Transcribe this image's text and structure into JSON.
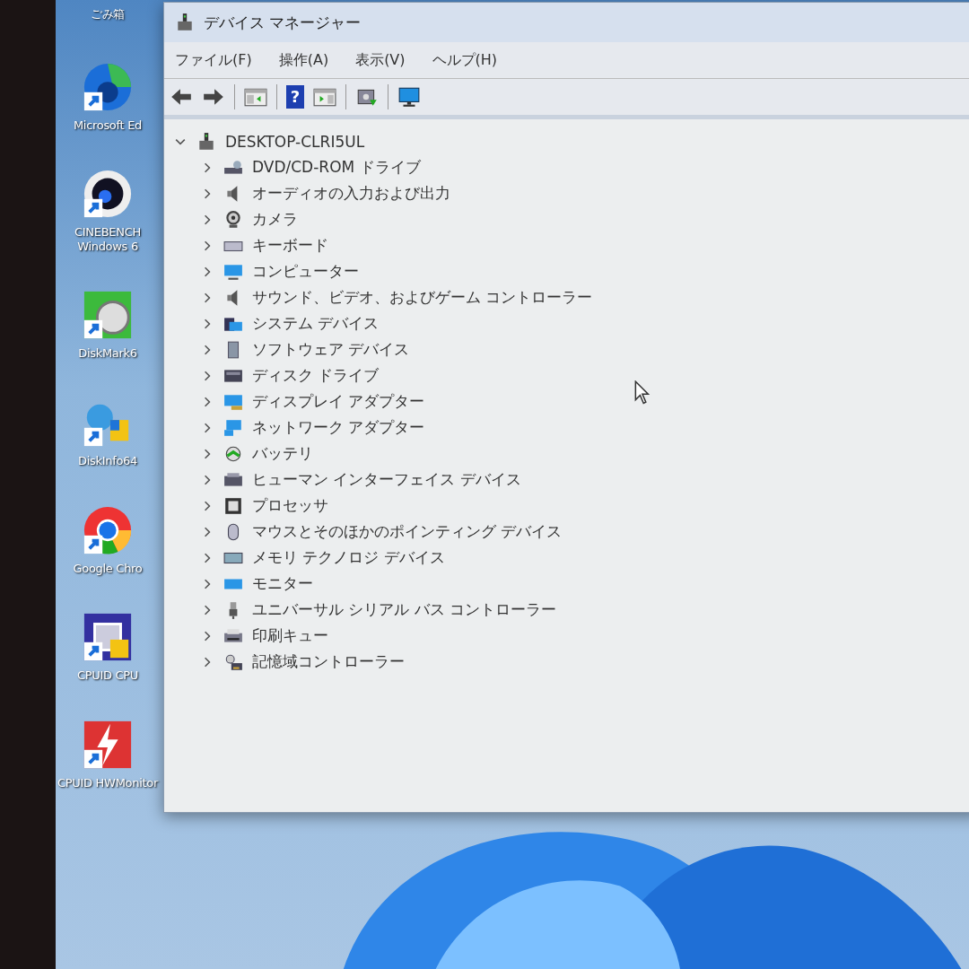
{
  "desktop_icons": [
    {
      "label": "ごみ箱"
    },
    {
      "label": "Microsoft Ed"
    },
    {
      "label": "CINEBENCH Windows 6"
    },
    {
      "label": "DiskMark6"
    },
    {
      "label": "DiskInfo64"
    },
    {
      "label": "Google Chro"
    },
    {
      "label": "CPUID CPU"
    },
    {
      "label": "CPUID HWMonitor"
    }
  ],
  "window": {
    "title": "デバイス マネージャー",
    "help_glyph": "?",
    "menu": [
      {
        "label": "ファイル(F)"
      },
      {
        "label": "操作(A)"
      },
      {
        "label": "表示(V)"
      },
      {
        "label": "ヘルプ(H)"
      }
    ],
    "tree": {
      "label": "DESKTOP-CLRI5UL",
      "expanded": true,
      "children": [
        {
          "label": "DVD/CD-ROM ドライブ",
          "expanded": false
        },
        {
          "label": "オーディオの入力および出力",
          "expanded": false
        },
        {
          "label": "カメラ",
          "expanded": false
        },
        {
          "label": "キーボード",
          "expanded": false
        },
        {
          "label": "コンピューター",
          "expanded": false
        },
        {
          "label": "サウンド、ビデオ、およびゲーム コントローラー",
          "expanded": false
        },
        {
          "label": "システム デバイス",
          "expanded": false
        },
        {
          "label": "ソフトウェア デバイス",
          "expanded": false
        },
        {
          "label": "ディスク ドライブ",
          "expanded": false
        },
        {
          "label": "ディスプレイ アダプター",
          "expanded": false
        },
        {
          "label": "ネットワーク アダプター",
          "expanded": false
        },
        {
          "label": "バッテリ",
          "expanded": false
        },
        {
          "label": "ヒューマン インターフェイス デバイス",
          "expanded": false
        },
        {
          "label": "プロセッサ",
          "expanded": false
        },
        {
          "label": "マウスとそのほかのポインティング デバイス",
          "expanded": false
        },
        {
          "label": "メモリ テクノロジ デバイス",
          "expanded": false
        },
        {
          "label": "モニター",
          "expanded": false
        },
        {
          "label": "ユニバーサル シリアル バス コントローラー",
          "expanded": false
        },
        {
          "label": "印刷キュー",
          "expanded": false
        },
        {
          "label": "記憶域コントローラー",
          "expanded": false
        }
      ]
    }
  }
}
